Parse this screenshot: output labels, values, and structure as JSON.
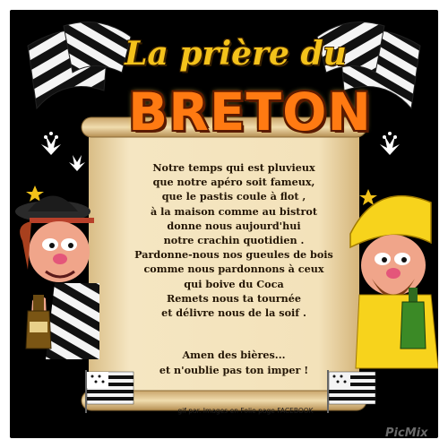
{
  "title": {
    "line1": "La prière du",
    "line2": "BRETON"
  },
  "prayer_lines": [
    "Notre temps qui est pluvieux",
    "que notre apéro soit fameux,",
    "que le pastis coule à flot ,",
    "à la maison comme au bistrot",
    "donne nous aujourd'hui",
    "notre crachin quotidien .",
    "Pardonne-nous nos gueules de bois",
    "comme nous pardonnons à ceux",
    "qui boive du Coca",
    "Remets nous ta tournée",
    "et délivre nous de la soif ."
  ],
  "closing_lines": [
    "Amen des bières...",
    "et n'oublie pas ton imper !"
  ],
  "credit": "gif par. Images en Folie page FACEBOOK",
  "watermark": "PicMix",
  "colors": {
    "background": "#000000",
    "parchment": "#f3e1b8",
    "title_gold": "#f4c21b",
    "title_orange": "#ff7a12",
    "text": "#241605"
  },
  "icons": [
    "breton-flag",
    "ermine",
    "star",
    "bottle"
  ]
}
